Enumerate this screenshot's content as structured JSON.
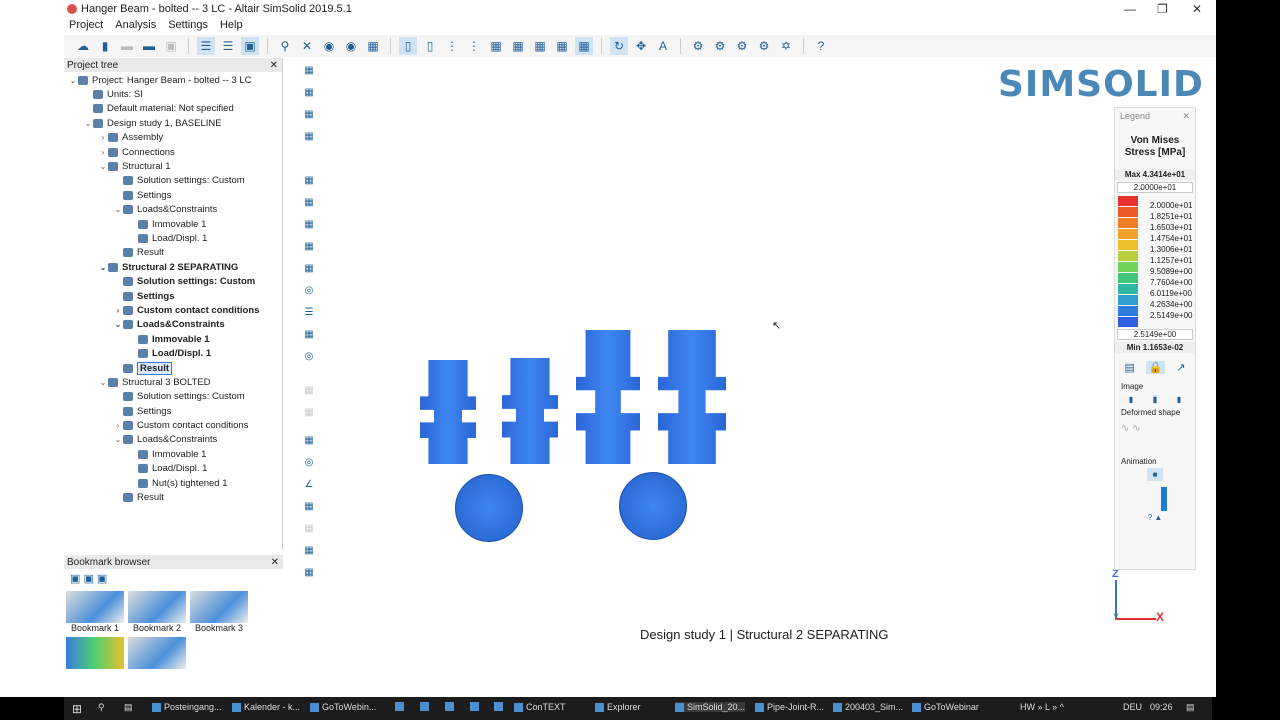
{
  "window": {
    "title": "Hanger Beam - bolted -- 3 LC - Altair SimSolid 2019.5.1"
  },
  "menu": [
    "Project",
    "Analysis",
    "Settings",
    "Help"
  ],
  "project_tree": {
    "title": "Project tree",
    "items": [
      {
        "label": "Project: Hanger Beam - bolted -- 3 LC",
        "level": 0,
        "exp": "v"
      },
      {
        "label": "Units: SI",
        "level": 1,
        "exp": ""
      },
      {
        "label": "Default material: Not specified",
        "level": 1,
        "exp": ""
      },
      {
        "label": "Design study 1, BASELINE",
        "level": 1,
        "exp": "v"
      },
      {
        "label": "Assembly",
        "level": 2,
        "exp": ">"
      },
      {
        "label": "Connections",
        "level": 2,
        "exp": ">"
      },
      {
        "label": "Structural  1",
        "level": 2,
        "exp": "v"
      },
      {
        "label": "Solution settings: Custom",
        "level": 3,
        "exp": ""
      },
      {
        "label": "Settings",
        "level": 3,
        "exp": ""
      },
      {
        "label": "Loads&Constraints",
        "level": 3,
        "exp": "v"
      },
      {
        "label": "Immovable 1",
        "level": 4,
        "exp": ""
      },
      {
        "label": "Load/Displ. 1",
        "level": 4,
        "exp": ""
      },
      {
        "label": "Result",
        "level": 3,
        "exp": ""
      },
      {
        "label": "Structural  2 SEPARATING",
        "level": 2,
        "exp": "v",
        "bold": true
      },
      {
        "label": "Solution settings: Custom",
        "level": 3,
        "exp": "",
        "bold": true
      },
      {
        "label": "Settings",
        "level": 3,
        "exp": "",
        "bold": true
      },
      {
        "label": "Custom contact conditions",
        "level": 3,
        "exp": ">",
        "bold": true
      },
      {
        "label": "Loads&Constraints",
        "level": 3,
        "exp": "v",
        "bold": true
      },
      {
        "label": "Immovable 1",
        "level": 4,
        "exp": "",
        "bold": true
      },
      {
        "label": "Load/Displ. 1",
        "level": 4,
        "exp": "",
        "bold": true
      },
      {
        "label": "Result",
        "level": 3,
        "exp": "",
        "bold": true,
        "selected": true
      },
      {
        "label": "Structural  3  BOLTED",
        "level": 2,
        "exp": "v"
      },
      {
        "label": "Solution settings: Custom",
        "level": 3,
        "exp": ""
      },
      {
        "label": "Settings",
        "level": 3,
        "exp": ""
      },
      {
        "label": "Custom contact conditions",
        "level": 3,
        "exp": ">"
      },
      {
        "label": "Loads&Constraints",
        "level": 3,
        "exp": "v"
      },
      {
        "label": "Immovable 1",
        "level": 4,
        "exp": ""
      },
      {
        "label": "Load/Displ. 1",
        "level": 4,
        "exp": ""
      },
      {
        "label": "Nut(s) tightened 1",
        "level": 4,
        "exp": ""
      },
      {
        "label": "Result",
        "level": 3,
        "exp": ""
      }
    ]
  },
  "bookmark_browser": {
    "title": "Bookmark browser",
    "items": [
      "Bookmark 1",
      "Bookmark 2",
      "Bookmark 3"
    ]
  },
  "logo": "SIMSOLID",
  "legend": {
    "title": "Legend",
    "quantity": "Von Mises Stress [MPa]",
    "max": "Max  4.3414e+01",
    "upper": "2.0000e+01",
    "lower": "2.5149e+00",
    "min": "Min  1.1653e-02",
    "values": [
      "2.0000e+01",
      "1.8251e+01",
      "1.6503e+01",
      "1.4754e+01",
      "1.3006e+01",
      "1.1257e+01",
      "9.5089e+00",
      "7.7604e+00",
      "6.0119e+00",
      "4.2634e+00",
      "2.5149e+00"
    ],
    "colors": [
      "#e8312f",
      "#ec5a2c",
      "#ef7d2a",
      "#f2a228",
      "#ecc02c",
      "#b9cc3a",
      "#6fd45a",
      "#3fc77a",
      "#2fb9a2",
      "#2ea0d0",
      "#2f7be0",
      "#2f5ee0"
    ],
    "image_label": "Image",
    "deformed_label": "Deformed shape",
    "animation_label": "Animation"
  },
  "viewport": {
    "caption": "Design study 1 | Structural  2 SEPARATING",
    "axes": {
      "z": "Z",
      "y": "Y",
      "x": "X"
    }
  },
  "taskbar": {
    "items": [
      "Posteingang...",
      "Kalender - k...",
      "GoToWebin...",
      "ConTEXT",
      "Explorer",
      "SimSolid_20...",
      "Pipe-Joint-R...",
      "200403_Sim...",
      "GoToWebinar"
    ],
    "tray": "HW  »  L  »  ^",
    "lang": "DEU",
    "time": "09:26"
  }
}
